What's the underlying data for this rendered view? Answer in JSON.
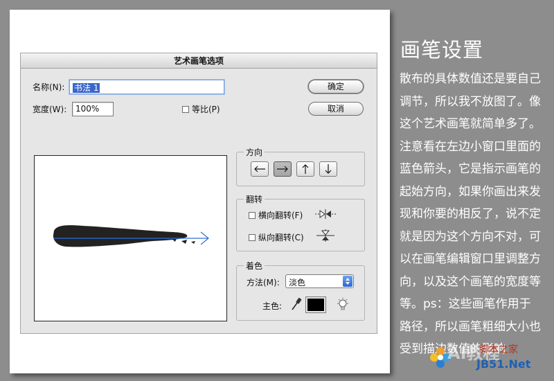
{
  "dialog": {
    "title": "艺术画笔选项",
    "name_label": "名称(N):",
    "name_value": "书法 1",
    "width_label": "宽度(W):",
    "width_value": "100%",
    "proportional_label": "等比(P)",
    "ok_label": "确定",
    "cancel_label": "取消",
    "direction": {
      "legend": "方向",
      "buttons": [
        "←",
        "→",
        "↑",
        "↓"
      ],
      "selected": "→"
    },
    "flip": {
      "legend": "翻转",
      "horizontal_label": "横向翻转(F)",
      "vertical_label": "纵向翻转(C)"
    },
    "colorize": {
      "legend": "着色",
      "method_label": "方法(M):",
      "method_value": "淡色",
      "key_color_label": "主色:"
    }
  },
  "panel": {
    "heading": "画笔设置",
    "body": "散布的具体数值还是要自己调节，所以我不放图了。像这个艺术画笔就简单多了。注意看在左边小窗口里面的蓝色箭头，它是指示画笔的起始方向，如果你画出来发现和你要的相反了，说不定就是因为这个方向不对，可以在画笔编辑窗口里调整方向，以及这个画笔的宽度等等。ps：这些画笔作用于路径，所以画笔粗细大小也受到描边数值的影响"
  },
  "watermark": {
    "text1": "脚本之家",
    "text2": "JB51.Net",
    "overlay_text": "AI教程"
  },
  "colors": {
    "accent_blue": "#3a66c8",
    "arrow_blue": "#2f6fd8",
    "background": "#8d8d8d"
  }
}
